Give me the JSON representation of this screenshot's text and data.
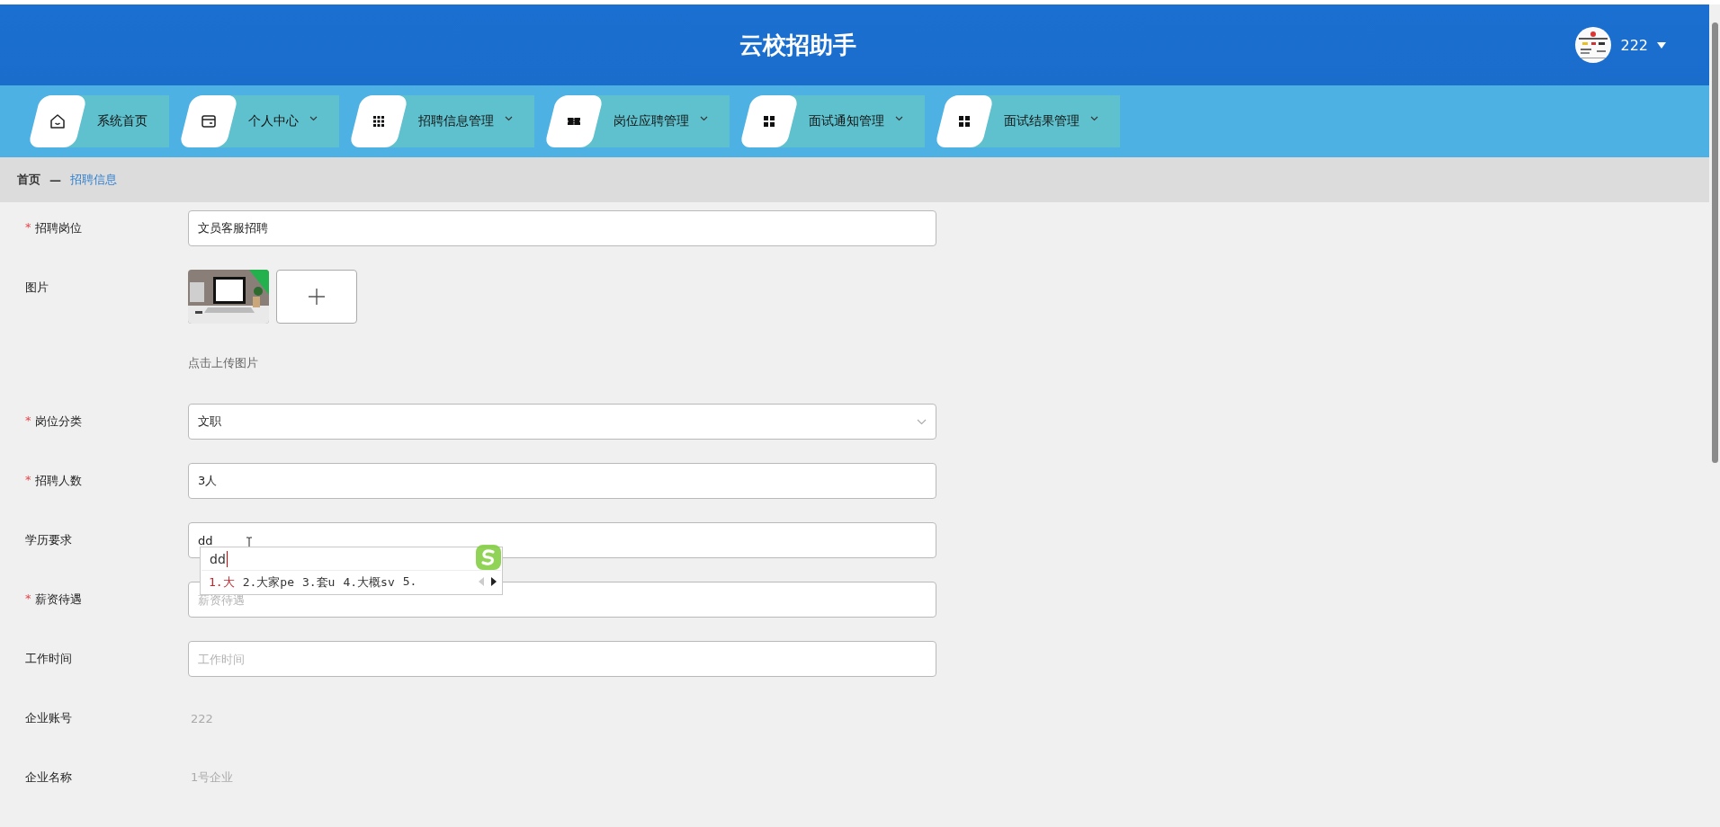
{
  "header": {
    "title": "云校招助手",
    "user": "222"
  },
  "nav": [
    {
      "label": "系统首页",
      "dropdown": false
    },
    {
      "label": "个人中心",
      "dropdown": true
    },
    {
      "label": "招聘信息管理",
      "dropdown": true
    },
    {
      "label": "岗位应聘管理",
      "dropdown": true
    },
    {
      "label": "面试通知管理",
      "dropdown": true
    },
    {
      "label": "面试结果管理",
      "dropdown": true
    }
  ],
  "breadcrumb": {
    "items": [
      {
        "label": "首页",
        "selected": false
      },
      {
        "label": "招聘信息",
        "selected": true
      }
    ],
    "separator": "—"
  },
  "form": {
    "fields": [
      {
        "label": "招聘岗位",
        "required_mark": "*",
        "kind": "input",
        "value": "文员客服招聘"
      },
      {
        "label": "图片",
        "hint": "点击上传图片"
      },
      {
        "label": "岗位分类",
        "required_mark": "*",
        "kind": "select",
        "value": "文职"
      },
      {
        "label": "招聘人数",
        "required_mark": "*",
        "kind": "input",
        "value": "3人"
      },
      {
        "label": "学历要求",
        "kind": "input",
        "value": "dd",
        "ime": {
          "composition": "dd",
          "candidates": [
            {
              "text": "1.大",
              "selected": true
            },
            {
              "text": "2.大家pe",
              "selected": false
            },
            {
              "text": "3.套u",
              "selected": false
            },
            {
              "text": "4.大概sv",
              "selected": false
            },
            {
              "text": "5.",
              "selected": false
            }
          ]
        }
      },
      {
        "label": "薪资待遇",
        "required_mark": "*",
        "kind": "input",
        "placeholder": "薪资待遇"
      },
      {
        "label": "工作时间",
        "kind": "input",
        "placeholder": "工作时间"
      },
      {
        "label": "企业账号",
        "kind": "readonly",
        "value": "222"
      },
      {
        "label": "企业名称",
        "kind": "readonly",
        "value": "1号企业"
      }
    ]
  }
}
